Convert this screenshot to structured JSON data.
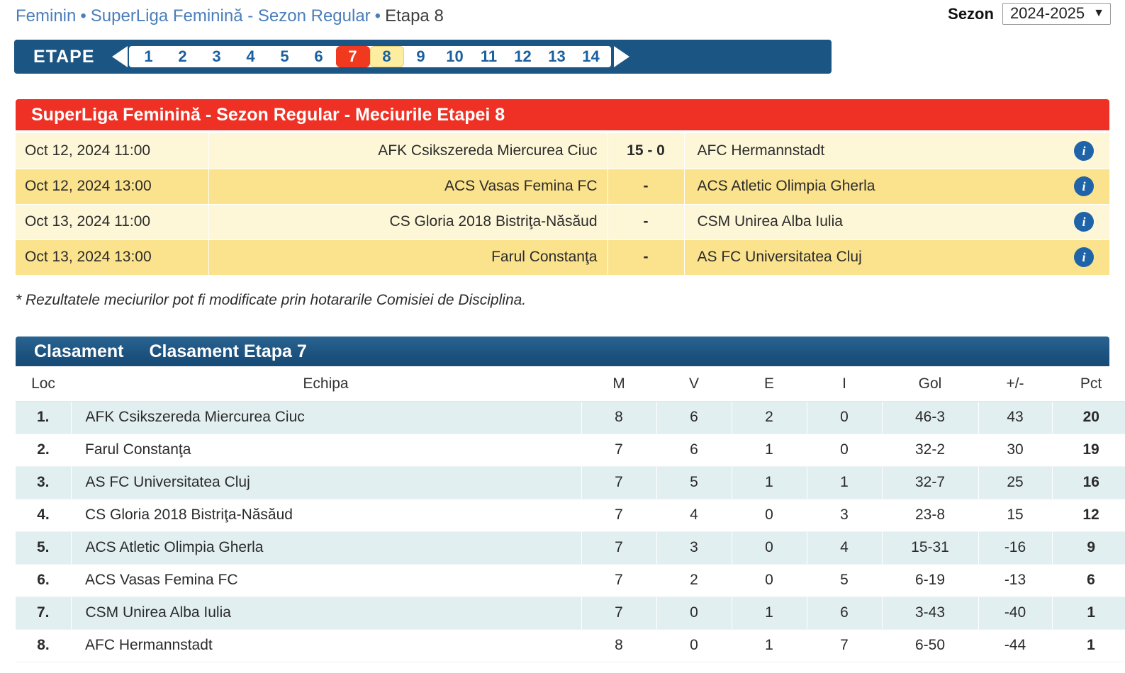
{
  "breadcrumb": {
    "part1": "Feminin",
    "sep1": "•",
    "part2": "SuperLiga Feminină - Sezon Regular",
    "sep2": "•",
    "part3": "Etapa 8"
  },
  "season": {
    "label": "Sezon",
    "value": "2024-2025",
    "caret": "⌄",
    "options": [
      "2024-2025"
    ]
  },
  "etape": {
    "title": "ETAPE",
    "prev_icon": "arrow-left-icon",
    "next_icon": "arrow-right-icon",
    "rounds": [
      "1",
      "2",
      "3",
      "4",
      "5",
      "6",
      "7",
      "8",
      "9",
      "10",
      "11",
      "12",
      "13",
      "14"
    ],
    "current_round": "7",
    "selected_round": "8",
    "current_color": "#f0391e",
    "selected_color": "#fdeda1",
    "bar_color": "#1b5583"
  },
  "matches": {
    "title": "SuperLiga Feminină - Sezon Regular - Meciurile Etapei 8",
    "title_color": "#ee3124",
    "info_icon": "info-icon",
    "rows": [
      {
        "date": "Oct 12, 2024 11:00",
        "home": "AFK Csikszereda Miercurea Ciuc",
        "score": "15 - 0",
        "away": "AFC Hermannstadt"
      },
      {
        "date": "Oct 12, 2024 13:00",
        "home": "ACS Vasas Femina FC",
        "score": "-",
        "away": "ACS Atletic Olimpia Gherla"
      },
      {
        "date": "Oct 13, 2024 11:00",
        "home": "CS Gloria 2018 Bistriţa-Năsăud",
        "score": "-",
        "away": "CSM Unirea Alba Iulia"
      },
      {
        "date": "Oct 13, 2024 13:00",
        "home": "Farul Constanţa",
        "score": "-",
        "away": "AS FC Universitatea Cluj"
      }
    ]
  },
  "disclaimer": "* Rezultatele meciurilor pot fi modificate prin hotararile Comisiei de Disciplina.",
  "standings": {
    "tabs": [
      {
        "label": "Clasament"
      },
      {
        "label": "Clasament Etapa 7"
      }
    ],
    "headers": [
      "Loc",
      "Echipa",
      "M",
      "V",
      "E",
      "I",
      "Gol",
      "+/-",
      "Pct"
    ],
    "rows": [
      {
        "loc": "1.",
        "team": "AFK Csikszereda Miercurea Ciuc",
        "m": "8",
        "v": "6",
        "e": "2",
        "i": "0",
        "gol": "46-3",
        "dif": "43",
        "pct": "20"
      },
      {
        "loc": "2.",
        "team": "Farul Constanţa",
        "m": "7",
        "v": "6",
        "e": "1",
        "i": "0",
        "gol": "32-2",
        "dif": "30",
        "pct": "19"
      },
      {
        "loc": "3.",
        "team": "AS FC Universitatea Cluj",
        "m": "7",
        "v": "5",
        "e": "1",
        "i": "1",
        "gol": "32-7",
        "dif": "25",
        "pct": "16"
      },
      {
        "loc": "4.",
        "team": "CS Gloria 2018 Bistriţa-Năsăud",
        "m": "7",
        "v": "4",
        "e": "0",
        "i": "3",
        "gol": "23-8",
        "dif": "15",
        "pct": "12"
      },
      {
        "loc": "5.",
        "team": "ACS Atletic Olimpia Gherla",
        "m": "7",
        "v": "3",
        "e": "0",
        "i": "4",
        "gol": "15-31",
        "dif": "-16",
        "pct": "9"
      },
      {
        "loc": "6.",
        "team": "ACS Vasas Femina FC",
        "m": "7",
        "v": "2",
        "e": "0",
        "i": "5",
        "gol": "6-19",
        "dif": "-13",
        "pct": "6"
      },
      {
        "loc": "7.",
        "team": "CSM Unirea Alba Iulia",
        "m": "7",
        "v": "0",
        "e": "1",
        "i": "6",
        "gol": "3-43",
        "dif": "-40",
        "pct": "1"
      },
      {
        "loc": "8.",
        "team": "AFC Hermannstadt",
        "m": "8",
        "v": "0",
        "e": "1",
        "i": "7",
        "gol": "6-50",
        "dif": "-44",
        "pct": "1"
      }
    ]
  }
}
